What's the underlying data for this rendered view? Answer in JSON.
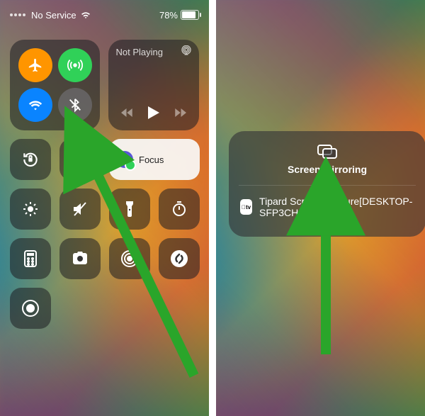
{
  "status": {
    "carrier": "No Service",
    "battery_pct": "78%"
  },
  "media": {
    "now_playing": "Not Playing"
  },
  "focus": {
    "label": "Focus"
  },
  "mirroring": {
    "title": "Screen Mirroring",
    "device": "Tipard Screen Capture[DESKTOP-SFP3CHJ]"
  },
  "icons": {
    "wifi": "wifi-icon",
    "airplane": "airplane-icon",
    "cellular": "cellular-antenna-icon",
    "bluetooth": "bluetooth-off-icon",
    "airplay": "airplay-icon",
    "rewind": "rewind-icon",
    "play": "play-icon",
    "forward": "forward-icon",
    "orientation_lock": "orientation-lock-icon",
    "screen_mirroring": "screen-mirroring-icon",
    "brightness": "brightness-icon",
    "mute": "mute-icon",
    "flashlight": "flashlight-icon",
    "timer": "timer-icon",
    "calculator": "calculator-icon",
    "camera": "camera-icon",
    "accessibility": "accessibility-icon",
    "shazam": "shazam-icon",
    "screen_record": "screen-record-icon",
    "apple_tv": "apple-tv-icon"
  },
  "colors": {
    "blue": "#0a84ff",
    "orange": "#ff9500",
    "green": "#30d158",
    "annotation": "#2aa52a"
  }
}
